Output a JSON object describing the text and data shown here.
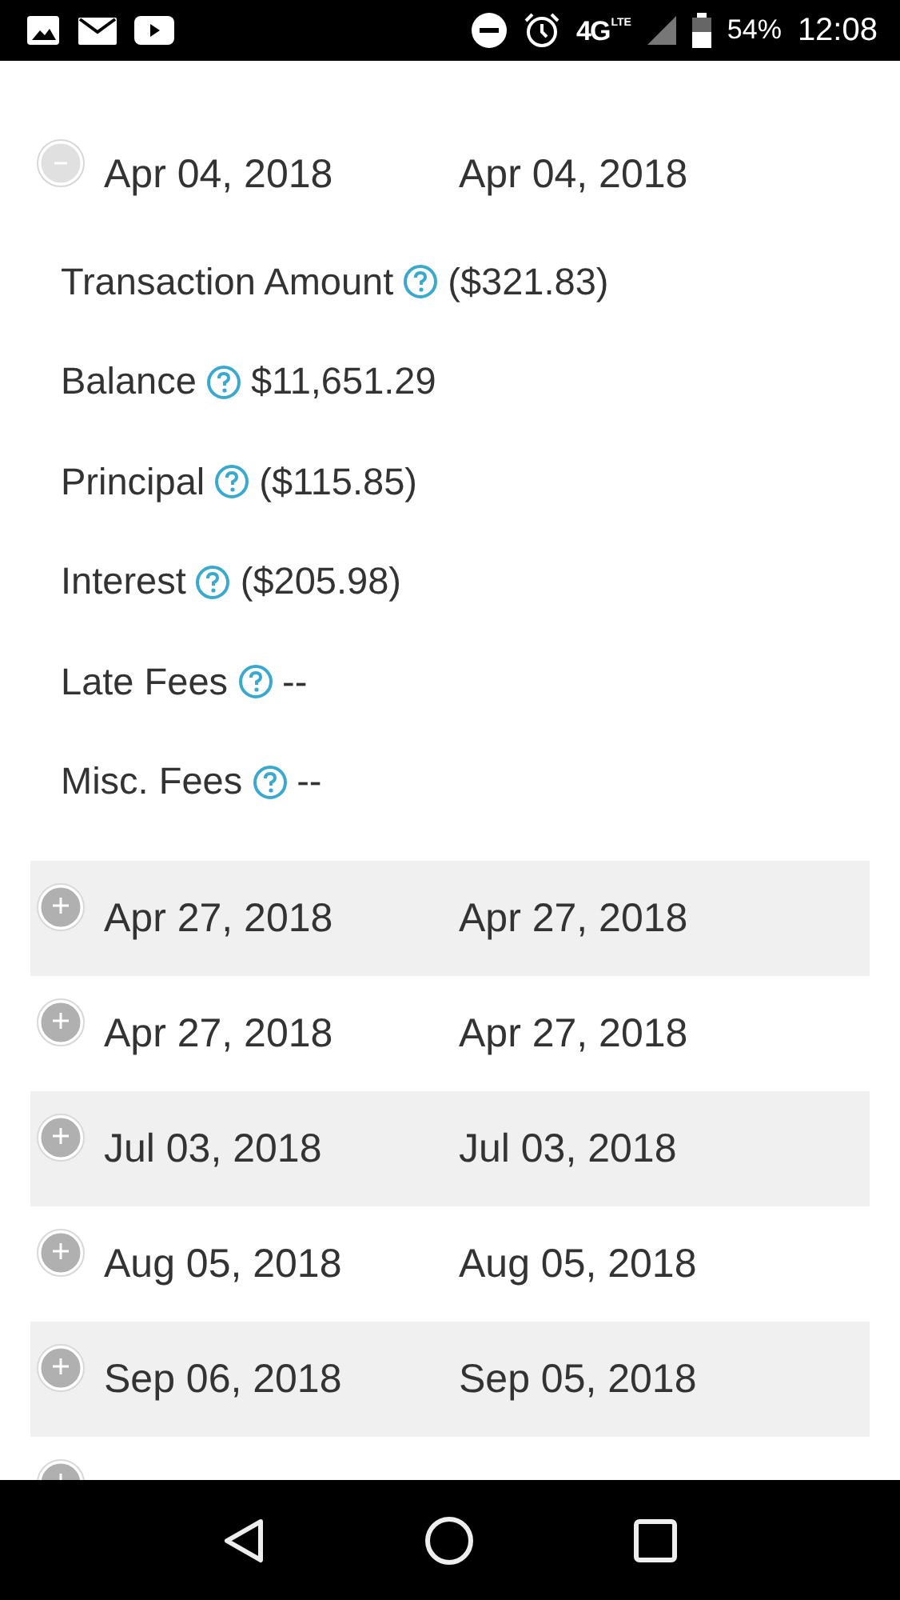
{
  "status_bar": {
    "network": "4G",
    "network_sub": "LTE",
    "battery": "54%",
    "time": "12:08"
  },
  "transactions": [
    {
      "expanded": true,
      "date_1": "Apr 04, 2018",
      "date_2": "Apr 04, 2018",
      "details": [
        {
          "label": "Transaction Amount",
          "value": "($321.83)"
        },
        {
          "label": "Balance",
          "value": "$11,651.29"
        },
        {
          "label": "Principal",
          "value": "($115.85)"
        },
        {
          "label": "Interest",
          "value": "($205.98)"
        },
        {
          "label": "Late Fees",
          "value": "--"
        },
        {
          "label": "Misc. Fees",
          "value": "--"
        }
      ]
    },
    {
      "expanded": false,
      "date_1": "Apr 27, 2018",
      "date_2": "Apr 27, 2018"
    },
    {
      "expanded": false,
      "date_1": "Apr 27, 2018",
      "date_2": "Apr 27, 2018"
    },
    {
      "expanded": false,
      "date_1": "Jul 03, 2018",
      "date_2": "Jul 03, 2018"
    },
    {
      "expanded": false,
      "date_1": "Aug 05, 2018",
      "date_2": "Aug 05, 2018"
    },
    {
      "expanded": false,
      "date_1": "Sep 06, 2018",
      "date_2": "Sep 05, 2018"
    },
    {
      "expanded": false
    }
  ]
}
